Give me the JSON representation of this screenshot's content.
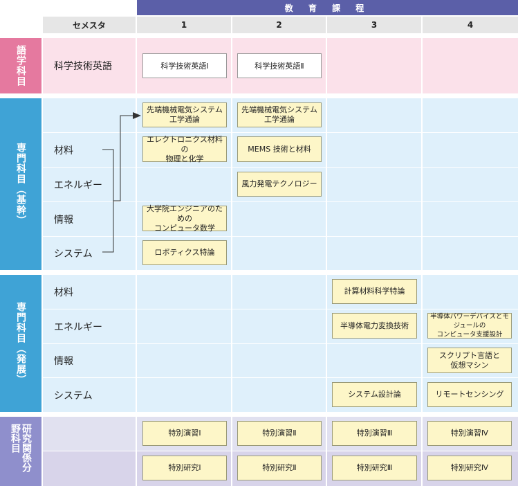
{
  "header": {
    "program_label": "教 育 課 程",
    "semester_label": "セメスタ",
    "columns": [
      "1",
      "2",
      "3",
      "4"
    ]
  },
  "language": {
    "band_label": "語学科目",
    "row_label": "科学技術英語",
    "courses": [
      "科学技術英語Ⅰ",
      "科学技術英語Ⅱ"
    ]
  },
  "basic": {
    "band_label": "専門科目（基幹）",
    "rows": [
      "材料",
      "エネルギー",
      "情報",
      "システム"
    ],
    "courses": {
      "c1": "先端機械電気システム\n工学通論",
      "c2": "先端機械電気システム\n工学通論",
      "c3": "エレクトロニクス材料の\n物理と化学",
      "c4": "MEMS 技術と材料",
      "c5": "風力発電テクノロジー",
      "c6": "大学院エンジニアのための\nコンピュータ数学",
      "c7": "ロボティクス特論"
    }
  },
  "advanced": {
    "band_label": "専門科目（発展）",
    "rows": [
      "材料",
      "エネルギー",
      "情報",
      "システム"
    ],
    "courses": {
      "c1": "計算材料科学特論",
      "c2": "半導体電力変換技術",
      "c3": "半導体パワーデバイスとモジュールの\nコンピュータ支援設計",
      "c4": "スクリプト言語と\n仮想マシン",
      "c5": "システム設計論",
      "c6": "リモートセンシング"
    }
  },
  "research": {
    "band_label": "研究関係分野科目",
    "practice": [
      "特別演習Ⅰ",
      "特別演習Ⅱ",
      "特別演習Ⅲ",
      "特別演習Ⅳ"
    ],
    "study": [
      "特別研究Ⅰ",
      "特別研究Ⅱ",
      "特別研究Ⅲ",
      "特別研究Ⅳ"
    ]
  },
  "colors": {
    "header": "#5b5fa8",
    "language": "#e5799f",
    "language_bg": "#fbe1ea",
    "basic": "#3fa3d6",
    "basic_bg": "#dff0fb",
    "research": "#8f8fcc",
    "research_bg": "#e1e1f0",
    "research_bg2": "#d8d4ea",
    "course_box": "#fdf6c8"
  }
}
